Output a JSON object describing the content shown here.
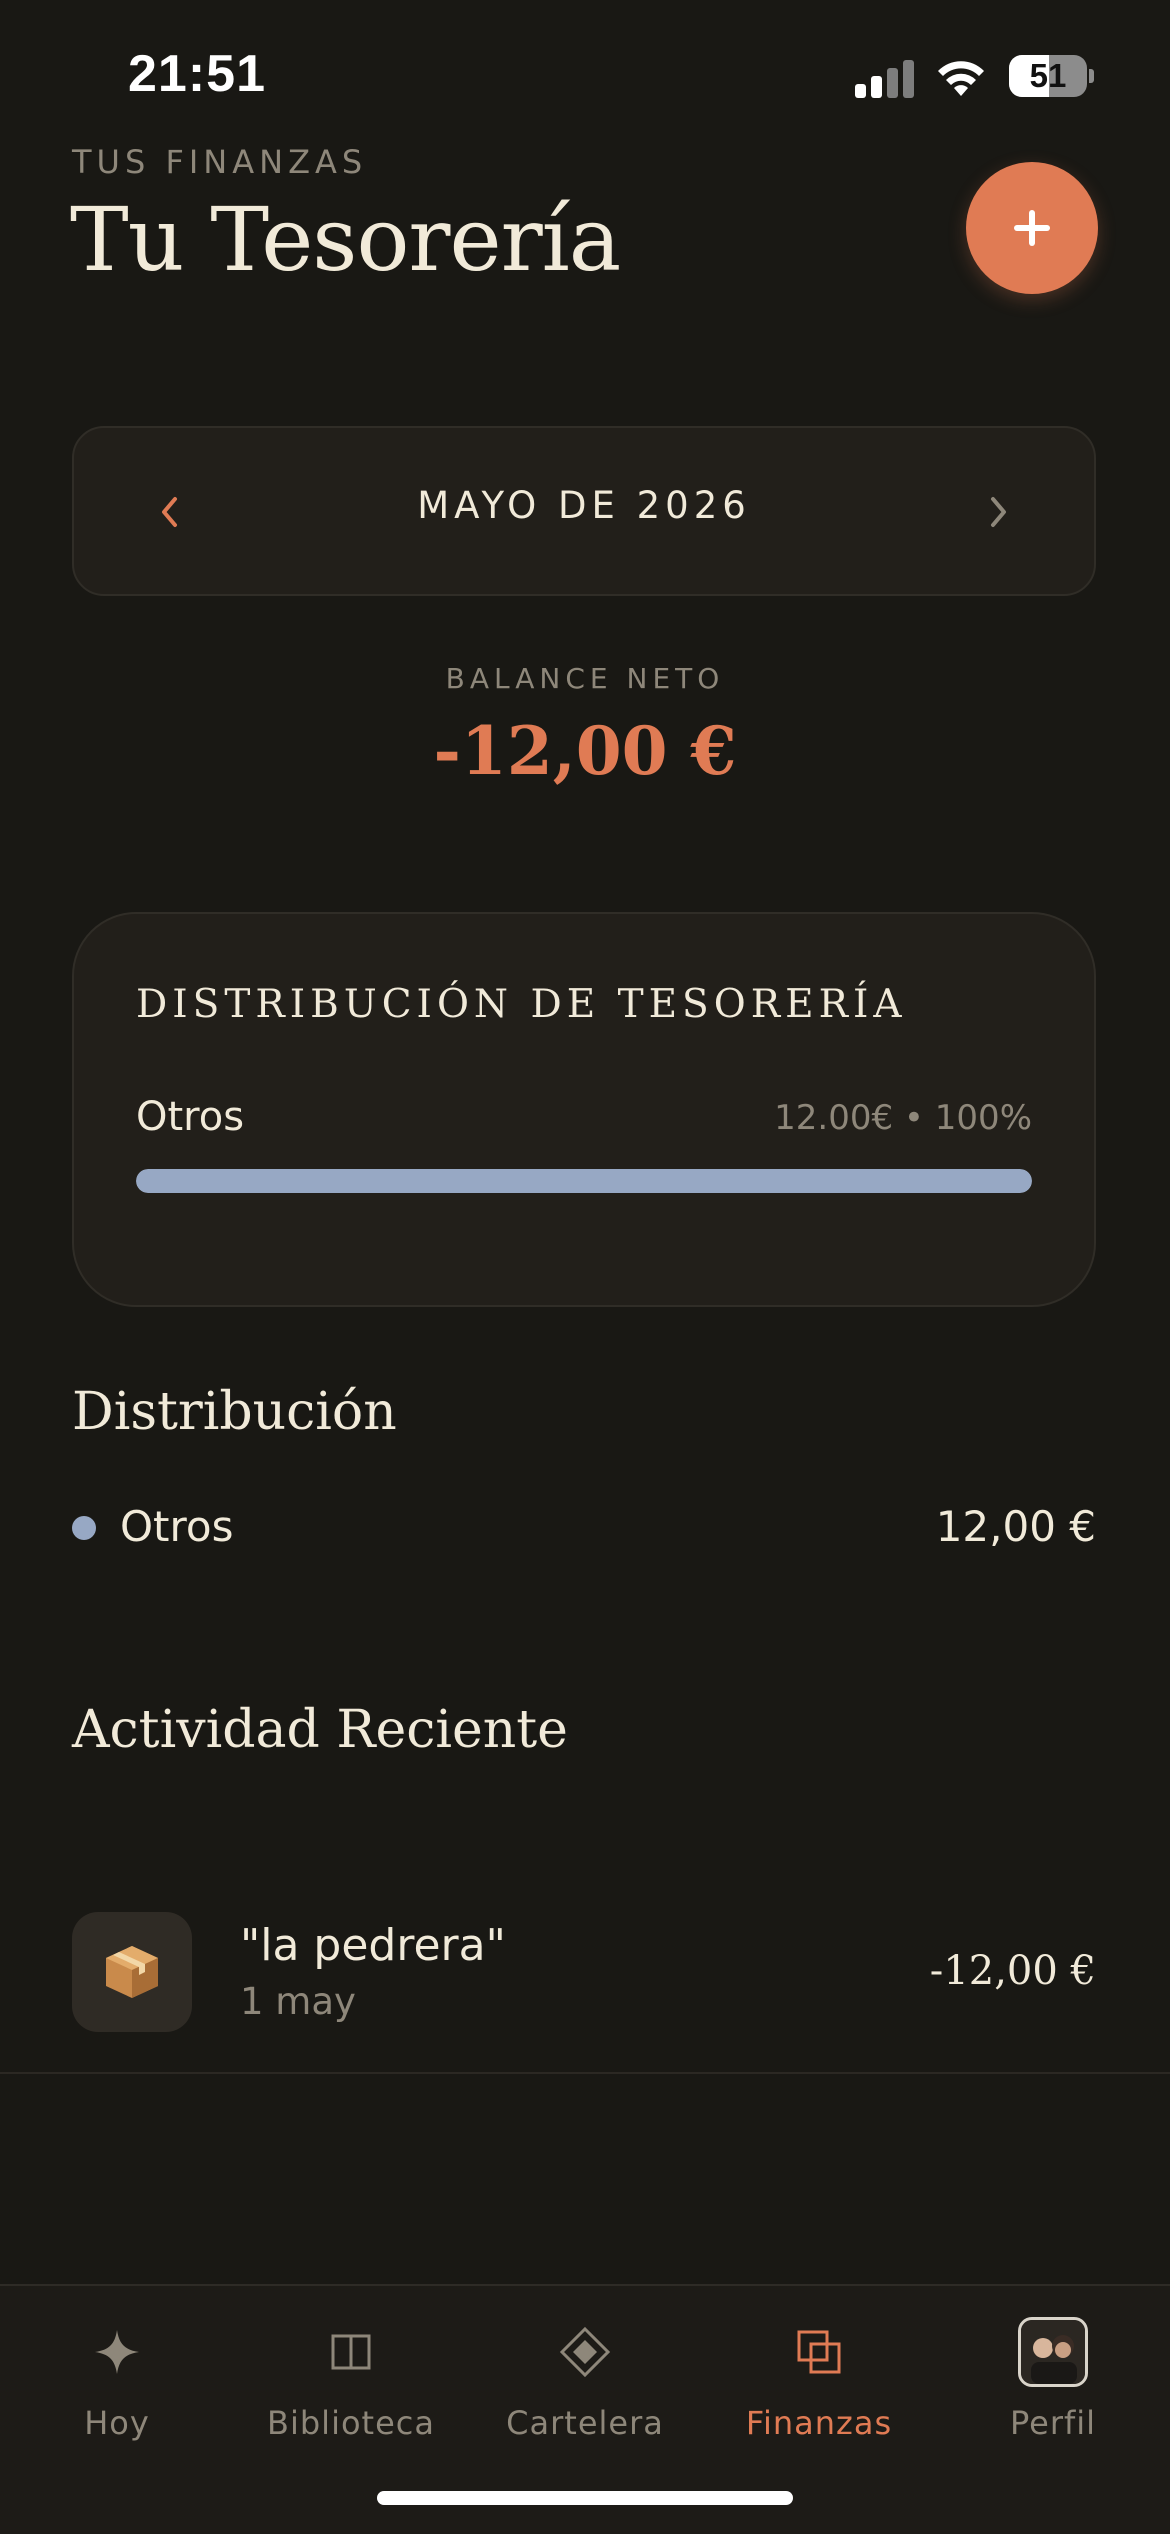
{
  "status_bar": {
    "time": "21:51",
    "battery": "51"
  },
  "header": {
    "eyebrow": "TUS FINANZAS",
    "title": "Tu Tesorería"
  },
  "month_selector": {
    "label": "MAYO DE 2026",
    "prev_glyph": "‹",
    "next_glyph": "›"
  },
  "balance": {
    "label": "BALANCE NETO",
    "value": "-12,00 €"
  },
  "distribution_card": {
    "title": "DISTRIBUCIÓN DE TESORERÍA",
    "rows": [
      {
        "label": "Otros",
        "meta": "12.00€ • 100%",
        "share": 1.0
      }
    ]
  },
  "distribution_section": {
    "title": "Distribución",
    "items": [
      {
        "label": "Otros",
        "value": "12,00 €"
      }
    ]
  },
  "activity_section": {
    "title": "Actividad Reciente",
    "items": [
      {
        "title": "\"la pedrera\"",
        "date": "1 may",
        "amount": "-12,00 €",
        "icon": "package-icon"
      }
    ]
  },
  "tabbar": {
    "tabs": [
      {
        "label": "Hoy",
        "icon": "sparkle-icon"
      },
      {
        "label": "Biblioteca",
        "icon": "book-icon"
      },
      {
        "label": "Cartelera",
        "icon": "diamond-icon"
      },
      {
        "label": "Finanzas",
        "icon": "stacked-squares-icon"
      },
      {
        "label": "Perfil",
        "icon": "avatar"
      }
    ],
    "active": "Finanzas"
  },
  "colors": {
    "background": "#191814",
    "card": "#221f1a",
    "accent": "#e07b54",
    "text": "#f1ead9",
    "muted": "#8e877a",
    "category_otros": "#97a8c4"
  }
}
